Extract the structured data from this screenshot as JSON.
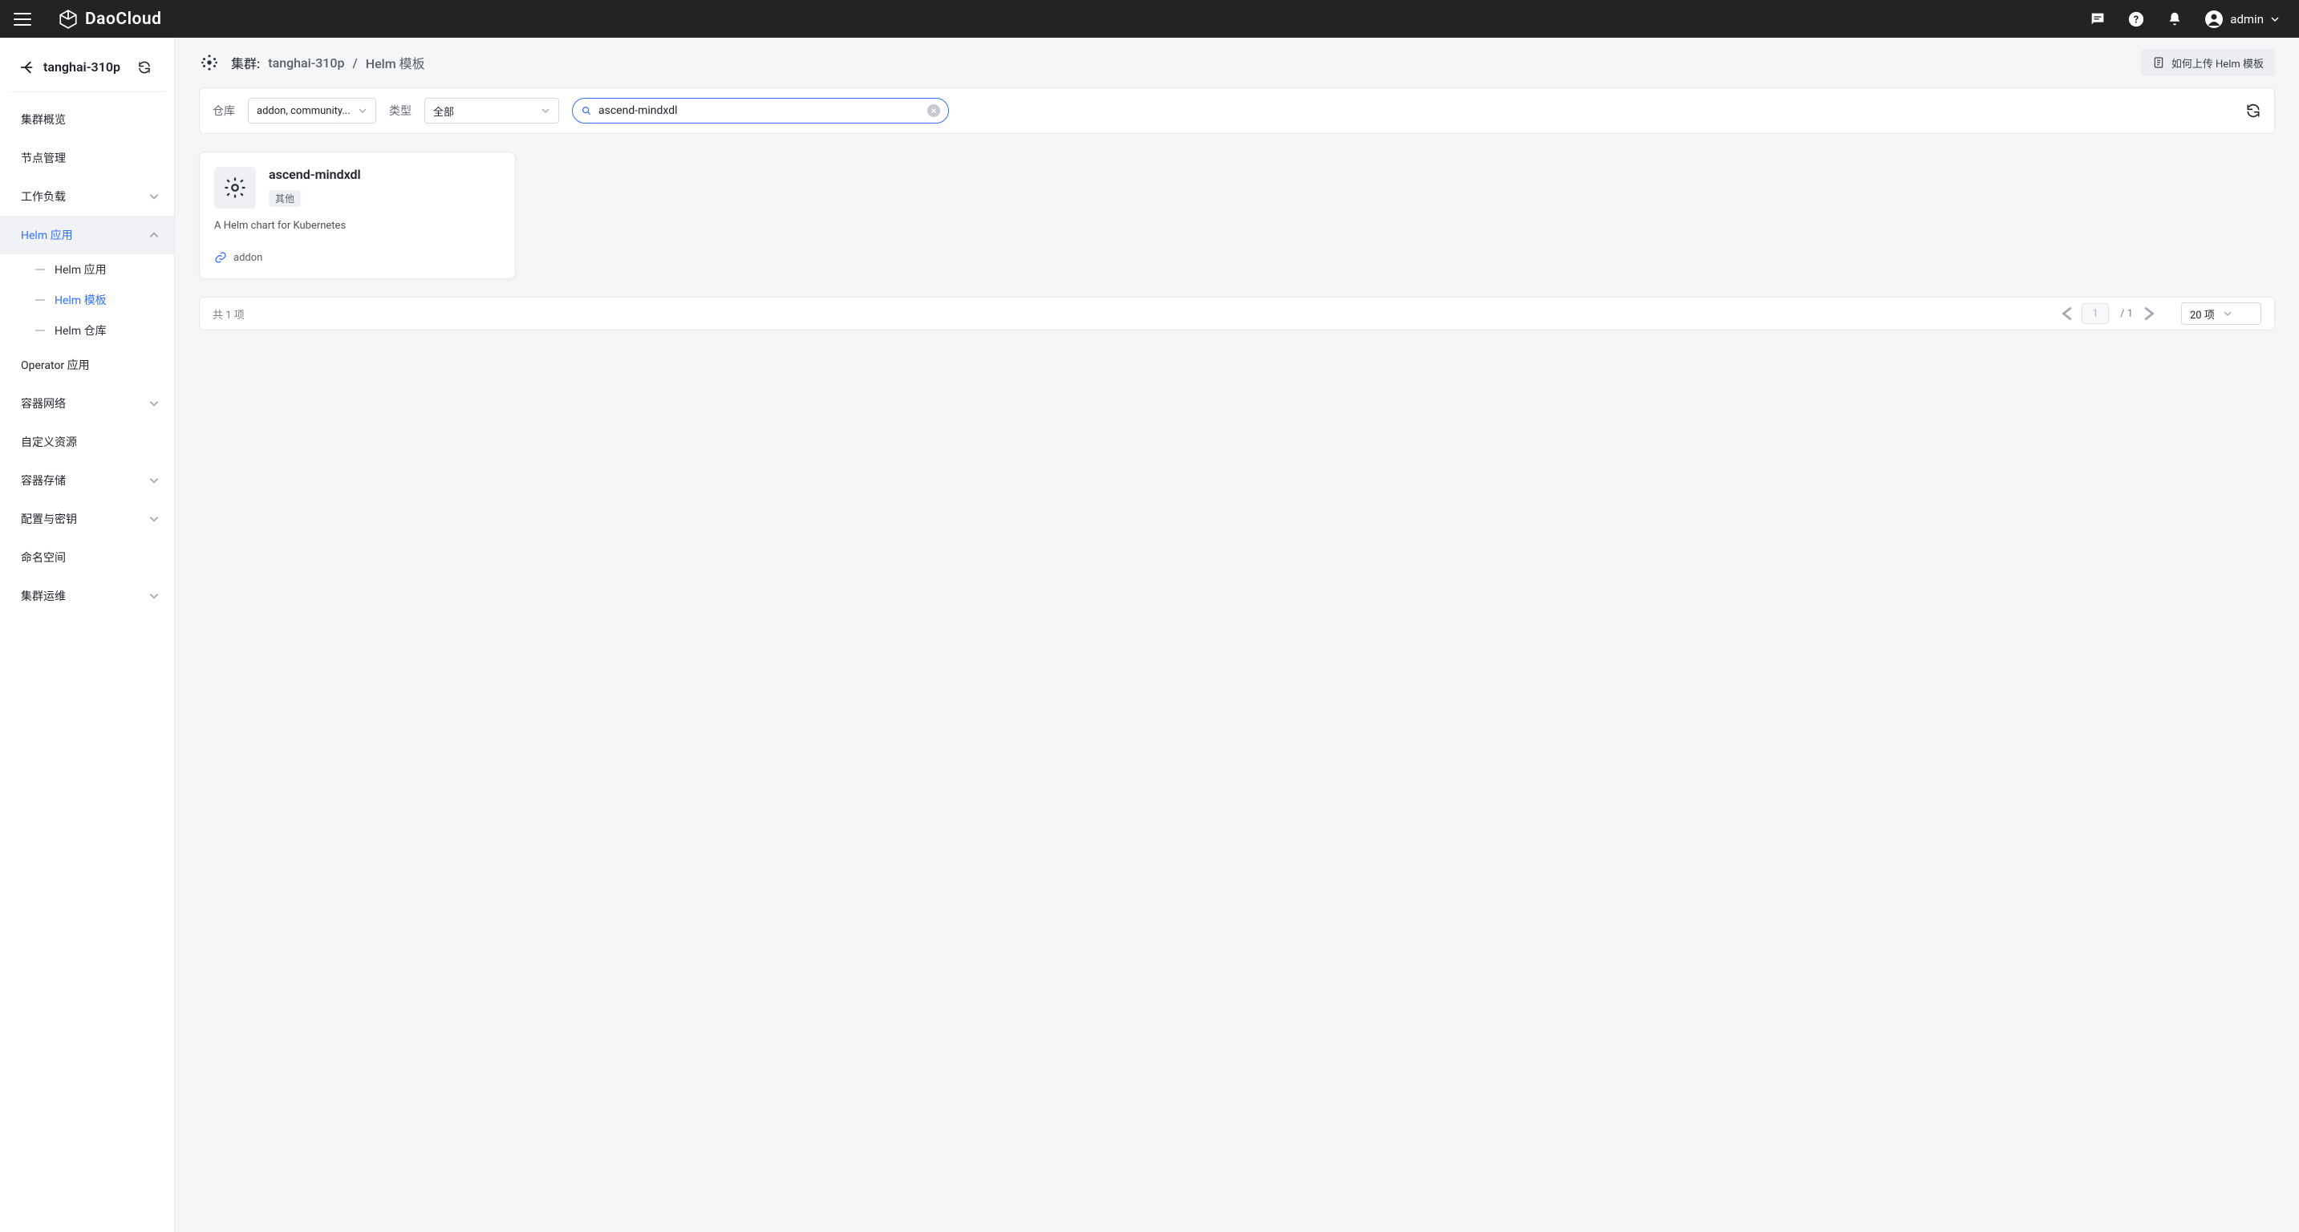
{
  "brand": {
    "name": "DaoCloud"
  },
  "user": {
    "name": "admin"
  },
  "sidebar": {
    "cluster_name": "tanghai-310p",
    "items": [
      {
        "label": "集群概览",
        "expandable": false
      },
      {
        "label": "节点管理",
        "expandable": false
      },
      {
        "label": "工作负载",
        "expandable": true,
        "expanded": false
      },
      {
        "label": "Helm 应用",
        "expandable": true,
        "expanded": true,
        "active": true,
        "children": [
          {
            "label": "Helm 应用"
          },
          {
            "label": "Helm 模板",
            "active": true
          },
          {
            "label": "Helm 仓库"
          }
        ]
      },
      {
        "label": "Operator 应用",
        "expandable": false
      },
      {
        "label": "容器网络",
        "expandable": true,
        "expanded": false
      },
      {
        "label": "自定义资源",
        "expandable": false
      },
      {
        "label": "容器存储",
        "expandable": true,
        "expanded": false
      },
      {
        "label": "配置与密钥",
        "expandable": true,
        "expanded": false
      },
      {
        "label": "命名空间",
        "expandable": false
      },
      {
        "label": "集群运维",
        "expandable": true,
        "expanded": false
      }
    ]
  },
  "breadcrumb": {
    "cluster_prefix": "集群:",
    "cluster": "tanghai-310p",
    "leaf": "Helm 模板",
    "howto": "如何上传 Helm 模板"
  },
  "filter": {
    "repo_label": "仓库",
    "repo_value": "addon, community...",
    "type_label": "类型",
    "type_value": "全部",
    "search_value": "ascend-mindxdl"
  },
  "cards": [
    {
      "title": "ascend-mindxdl",
      "tag": "其他",
      "desc": "A Helm chart for Kubernetes",
      "repo": "addon"
    }
  ],
  "pager": {
    "total_text": "共 1 项",
    "page": "1",
    "total_pages": "1",
    "size_label": "20 项"
  }
}
